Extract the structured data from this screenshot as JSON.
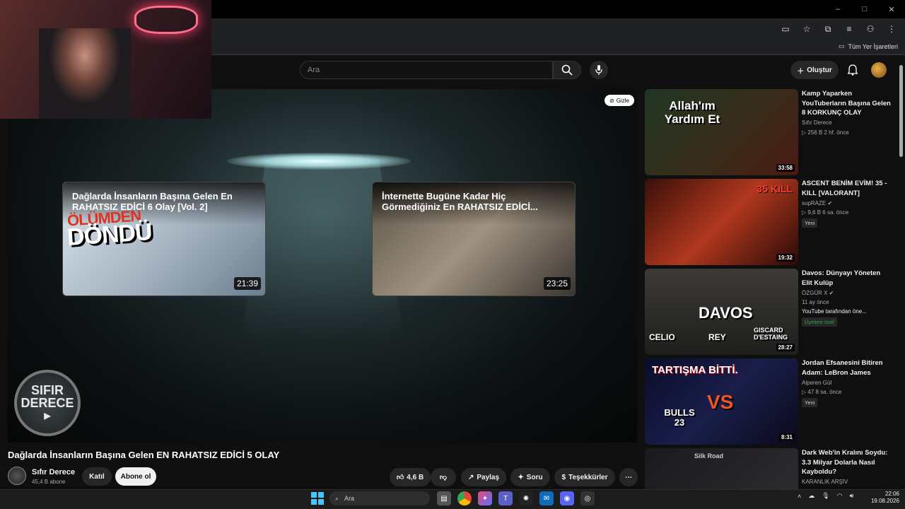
{
  "browser": {
    "bookmarks_label": "Tüm Yer İşaretleri",
    "window_controls": [
      "–",
      "□",
      "✕"
    ]
  },
  "header": {
    "search_placeholder": "Ara",
    "create_label": "Oluştur"
  },
  "player": {
    "hide_label": "Gizle",
    "channel_logo_line1": "SIFIR",
    "channel_logo_line2": "DERECE",
    "endcards": [
      {
        "title": "Dağlarda İnsanların Başına Gelen En RAHATSIZ EDİCİ 6 Olay [Vol. 2]",
        "duration": "21:39",
        "art_top": "ÖLÜMDEN",
        "art": "DÖNDÜ"
      },
      {
        "title": "İnternette Bugüne Kadar Hiç Görmediğiniz En RAHATSIZ EDİCİ...",
        "duration": "23:25"
      }
    ]
  },
  "video": {
    "title": "Dağlarda İnsanların Başına Gelen EN RAHATSIZ EDİCİ 5 OLAY",
    "channel": "Sıfır Derece",
    "subscribers": "45,4 B abone",
    "join_label": "Katıl",
    "subscribe_label": "Abone ol",
    "likes": "4,6 B",
    "share_label": "Paylaş",
    "ask_label": "Soru",
    "thanks_label": "Teşekkürler"
  },
  "sidebar": [
    {
      "title": "Kamp Yaparken YouTuberların Başına Gelen 8 KORKUNÇ OLAY",
      "channel": "Sıfır Derece",
      "meta": "▷ 256 B  2 hf. önce",
      "duration": "33:58",
      "thumb_text": "Allah'ım Yardım Et"
    },
    {
      "title": "ASCENT BENİM EVİM!  35 - KILL [VALORANT]",
      "channel": "supRAZE ✔",
      "meta": "▷ 9,6 B  6 sa. önce",
      "badge": "Yeni",
      "duration": "19:32",
      "thumb_text": "35 KILL"
    },
    {
      "title": "Davos: Dünyayı Yöneten Elit Kulüp",
      "channel": "ÖZGÜR X ✔",
      "meta": "11 ay önce",
      "extra": "YouTube tarafından öne...",
      "badge": "Üyelere özel",
      "duration": "28:27",
      "thumb_text": "DAVOS",
      "thumb_labels": [
        "CELIO",
        "REY",
        "GISCARD D'ESTAING"
      ]
    },
    {
      "title": "Jordan Efsanesini Bitiren Adam: LeBron James",
      "channel": "Alperen Gül",
      "meta": "▷ 47  8 sa. önce",
      "badge": "Yeni",
      "duration": "8:31",
      "thumb_text": "TARTIŞMA BİTTİ.",
      "thumb_vs": "VS",
      "thumb_jersey": "BULLS 23"
    },
    {
      "title": "Dark Web'in Kralını Soydu: 3.3 Milyar Dolarla Nasıl Kayboldu?",
      "channel": "KARANLIK ARŞİV",
      "thumb_text": "Silk Road"
    }
  ],
  "taskbar": {
    "search_placeholder": "Ara",
    "time": "22:06",
    "date": "19.08.2026"
  },
  "colors": {
    "accent": "#3ea6ff",
    "background": "#0f0f0f",
    "pill": "#272727",
    "member_badge": "#2ba640"
  }
}
